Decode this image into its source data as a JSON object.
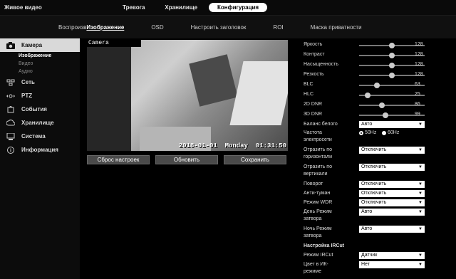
{
  "topbar": {
    "brand": "Живое видео",
    "tabs": [
      {
        "label": "Тревога"
      },
      {
        "label": "Хранилище"
      },
      {
        "label": "Конфигурация"
      }
    ]
  },
  "subbar": {
    "items": [
      {
        "label": "Воспроизв"
      },
      {
        "label": "Изображение"
      },
      {
        "label": "OSD"
      },
      {
        "label": "Настроить заголовок"
      },
      {
        "label": "ROI"
      },
      {
        "label": "Маска приватности"
      }
    ]
  },
  "sidebar": {
    "sections": [
      {
        "label": "Камера",
        "icon": "camera-icon",
        "subs": [
          {
            "label": "Изображение"
          },
          {
            "label": "Видео"
          },
          {
            "label": "Аудио"
          }
        ]
      },
      {
        "label": "Сеть",
        "icon": "network-icon"
      },
      {
        "label": "PTZ",
        "icon": "ptz-icon"
      },
      {
        "label": "События",
        "icon": "events-icon"
      },
      {
        "label": "Хранилище",
        "icon": "storage-icon"
      },
      {
        "label": "Система",
        "icon": "system-icon"
      },
      {
        "label": "Информация",
        "icon": "info-icon"
      }
    ]
  },
  "video": {
    "label": "Camera",
    "timestamp": "2018-01-01  Monday  01:31:50"
  },
  "video_buttons": {
    "reset": "Сброс настроек",
    "refresh": "Обновить",
    "save": "Сохранить"
  },
  "sliders": [
    {
      "label": "Яркость",
      "value": "128",
      "level": 128
    },
    {
      "label": "Контраст",
      "value": "128",
      "level": 128
    },
    {
      "label": "Насыщенность",
      "value": "128",
      "level": 128
    },
    {
      "label": "Резкость",
      "value": "128",
      "level": 128
    },
    {
      "label": "BLC",
      "value": "63",
      "level": 63
    },
    {
      "label": "HLC",
      "value": "25",
      "level": 25
    },
    {
      "label": "2D DNR",
      "value": "86",
      "level": 86
    },
    {
      "label": "3D DNR",
      "value": "99",
      "level": 99
    }
  ],
  "settings": {
    "white_balance_label": "Баланс белого",
    "white_balance_value": "Авто",
    "freq_label_1": "Частота",
    "freq_label_2": "электросети",
    "freq_opt_1": "50Hz",
    "freq_opt_2": "60Hz",
    "flip_h_label_1": "Отразить по",
    "flip_h_label_2": "горизонтали",
    "flip_h_value": "Отключить",
    "flip_v_label_1": "Отразить по",
    "flip_v_label_2": "вертикали",
    "flip_v_value": "Отключить",
    "rotate_label": "Поворот",
    "rotate_value": "Отключить",
    "antifog_label": "Анти-туман",
    "antifog_value": "Отключить",
    "wdr_label": "Режим WDR",
    "wdr_value": "Отключить",
    "day_label_1": "День Режим",
    "day_label_2": "затвора",
    "day_value": "Авто",
    "night_label_1": "Ночь Режим",
    "night_label_2": "затвора",
    "night_value": "Авто",
    "ircut_title": "Настройка IRCut",
    "ircut_mode_label": "Режим IRCut",
    "ircut_mode_value": "Датчик",
    "ir_color_label_1": "Цвет в ИК-",
    "ir_color_label_2": "режиме",
    "ir_color_value": "Нет"
  }
}
